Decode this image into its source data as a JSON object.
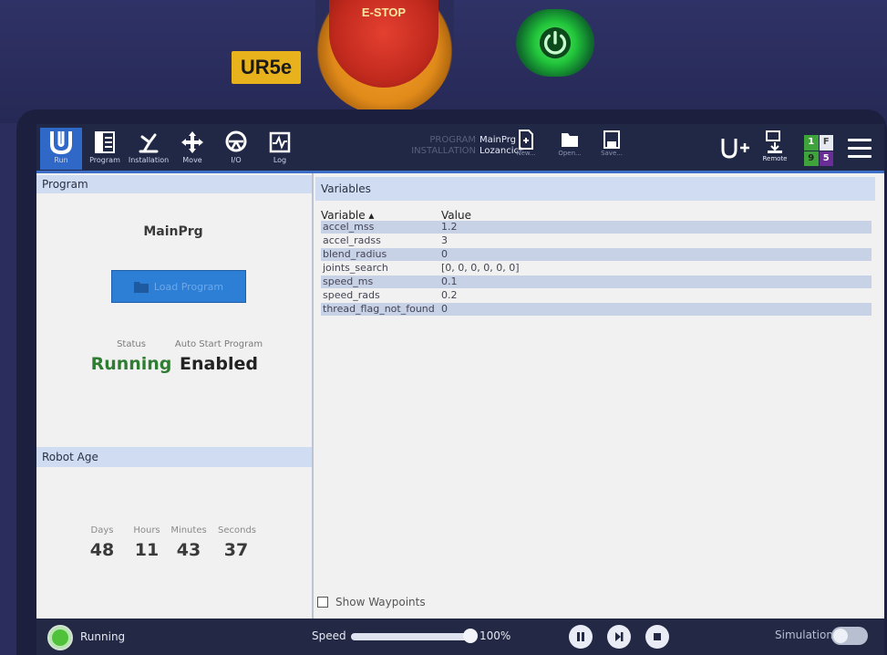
{
  "hardware": {
    "model_label": "UR5e",
    "estop_label": "E-STOP"
  },
  "header": {
    "nav": [
      {
        "label": "Run",
        "icon": "ur-logo-icon",
        "active": true
      },
      {
        "label": "Program",
        "icon": "program-icon"
      },
      {
        "label": "Installation",
        "icon": "installation-icon"
      },
      {
        "label": "Move",
        "icon": "move-icon"
      },
      {
        "label": "I/O",
        "icon": "io-icon"
      },
      {
        "label": "Log",
        "icon": "log-icon"
      }
    ],
    "program_key": "PROGRAM",
    "program_value": "MainPrg",
    "installation_key": "INSTALLATION",
    "installation_value": "Lozancic*",
    "file_buttons": [
      {
        "label": "New..."
      },
      {
        "label": "Open..."
      },
      {
        "label": "Save..."
      }
    ],
    "remote_label": "Remote",
    "counter": [
      "1",
      "F",
      "9",
      "5"
    ]
  },
  "program_panel": {
    "title": "Program",
    "program_name": "MainPrg",
    "load_button": "Load Program",
    "status_label": "Status",
    "status_value": "Running",
    "autostart_label": "Auto Start Program",
    "autostart_value": "Enabled"
  },
  "robot_age": {
    "title": "Robot Age",
    "labels": [
      "Days",
      "Hours",
      "Minutes",
      "Seconds"
    ],
    "values": [
      "48",
      "11",
      "43",
      "37"
    ]
  },
  "variables": {
    "title": "Variables",
    "col_variable": "Variable ▴",
    "col_value": "Value",
    "rows": [
      {
        "name": "accel_mss",
        "value": "1.2"
      },
      {
        "name": "accel_radss",
        "value": "3"
      },
      {
        "name": "blend_radius",
        "value": "0"
      },
      {
        "name": "joints_search",
        "value": "[0, 0, 0, 0, 0, 0]"
      },
      {
        "name": "speed_ms",
        "value": "0.1"
      },
      {
        "name": "speed_rads",
        "value": "0.2"
      },
      {
        "name": "thread_flag_not_found",
        "value": "0"
      }
    ],
    "show_waypoints": "Show Waypoints"
  },
  "footer": {
    "status": "Running",
    "speed_label": "Speed",
    "speed_value": "100%",
    "speed_fraction": 1.0,
    "simulation_label": "Simulation"
  },
  "colors": {
    "running_green": "#2e7d32",
    "accent_blue": "#2f68c6"
  }
}
